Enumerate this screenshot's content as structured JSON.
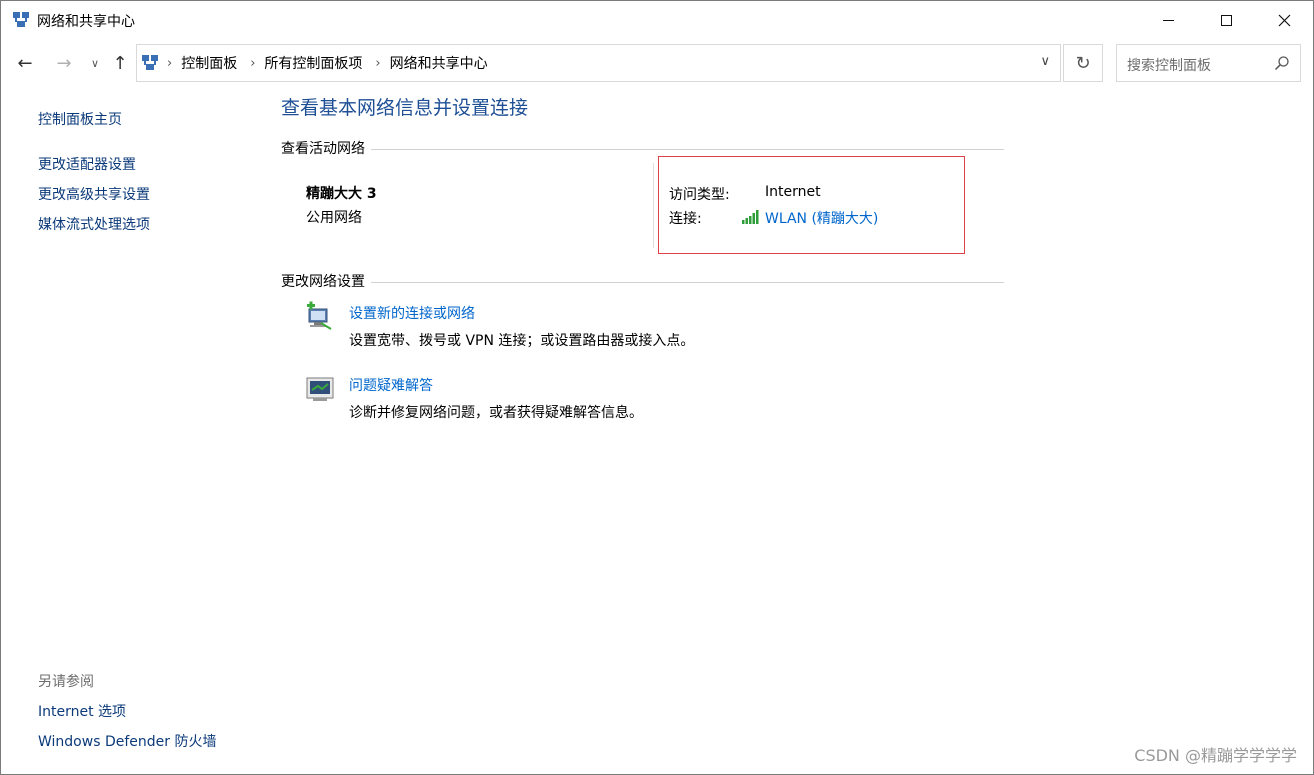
{
  "window": {
    "title": "网络和共享中心"
  },
  "nav": {
    "back_icon": "←",
    "forward_icon": "→",
    "recent_icon": "∨",
    "up_icon": "↑",
    "breadcrumbs": [
      "控制面板",
      "所有控制面板项",
      "网络和共享中心"
    ],
    "dropdown_icon": "∨",
    "refresh_icon": "↻"
  },
  "search": {
    "placeholder": "搜索控制面板"
  },
  "sidebar": {
    "home": "控制面板主页",
    "links": [
      "更改适配器设置",
      "更改高级共享设置",
      "媒体流式处理选项"
    ],
    "see_also_title": "另请参阅",
    "see_also": [
      "Internet 选项",
      "Windows Defender 防火墙"
    ]
  },
  "main": {
    "title": "查看基本网络信息并设置连接",
    "active_section": "查看活动网络",
    "network_name": "精蹦大大 3",
    "network_type": "公用网络",
    "access_type_label": "访问类型:",
    "access_type_value": "Internet",
    "connection_label": "连接:",
    "connection_value": "WLAN (精蹦大大)",
    "change_section": "更改网络设置",
    "tasks": [
      {
        "title": "设置新的连接或网络",
        "desc": "设置宽带、拨号或 VPN 连接；或设置路由器或接入点。"
      },
      {
        "title": "问题疑难解答",
        "desc": "诊断并修复网络问题，或者获得疑难解答信息。"
      }
    ]
  },
  "watermark": "CSDN @精蹦学学学学",
  "colors": {
    "link": "#0066cc",
    "title": "#1e4f95",
    "highlight_border": "#e0404a",
    "signal": "#2e9e3a"
  }
}
